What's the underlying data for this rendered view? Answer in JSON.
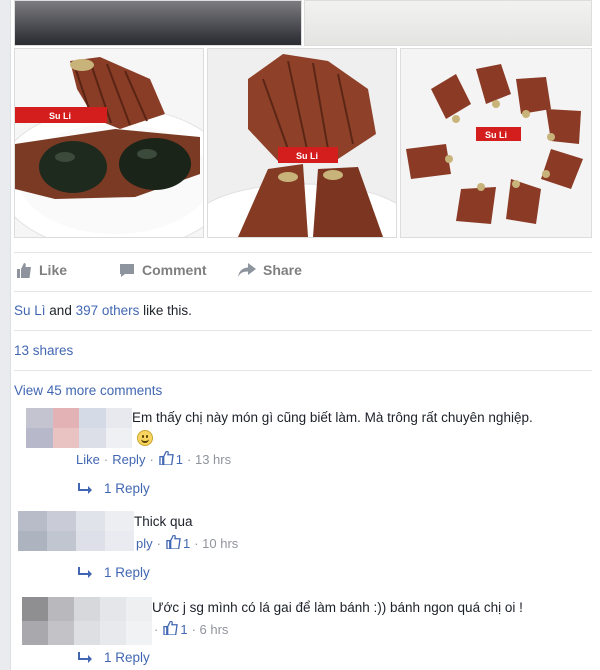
{
  "photos": {
    "watermark": "Su Li"
  },
  "actions": {
    "like_label": "Like",
    "comment_label": "Comment",
    "share_label": "Share"
  },
  "likes": {
    "name": "Su Lì",
    "and": "and",
    "others": "397 others",
    "suffix": "like this."
  },
  "shares": "13 shares",
  "view_more": "View 45 more comments",
  "comments": [
    {
      "text": "Em thấy chị này món gì cũng biết làm. Mà trông rất chuyên nghiệp.",
      "has_emoji": true,
      "meta": {
        "like": "Like",
        "dot": "·",
        "reply": "Reply",
        "sep": "·",
        "count": "1",
        "time": "· 13 hrs"
      },
      "replies": "1 Reply"
    },
    {
      "text": "Thick qua",
      "meta": {
        "reply": "ply",
        "sep": "·",
        "count": "1",
        "time": "· 10 hrs"
      },
      "replies": "1 Reply"
    },
    {
      "text": "Ước j sg mình có lá gai để làm bánh :)) bánh ngon quá chị oi !",
      "meta": {
        "reply": "",
        "sep": "·",
        "count": "1",
        "time": "· 6 hrs"
      },
      "replies": "1 Reply"
    }
  ],
  "colors": {
    "link": "#4267b2",
    "muted": "#90949c",
    "leaf": "#7a3a24"
  }
}
